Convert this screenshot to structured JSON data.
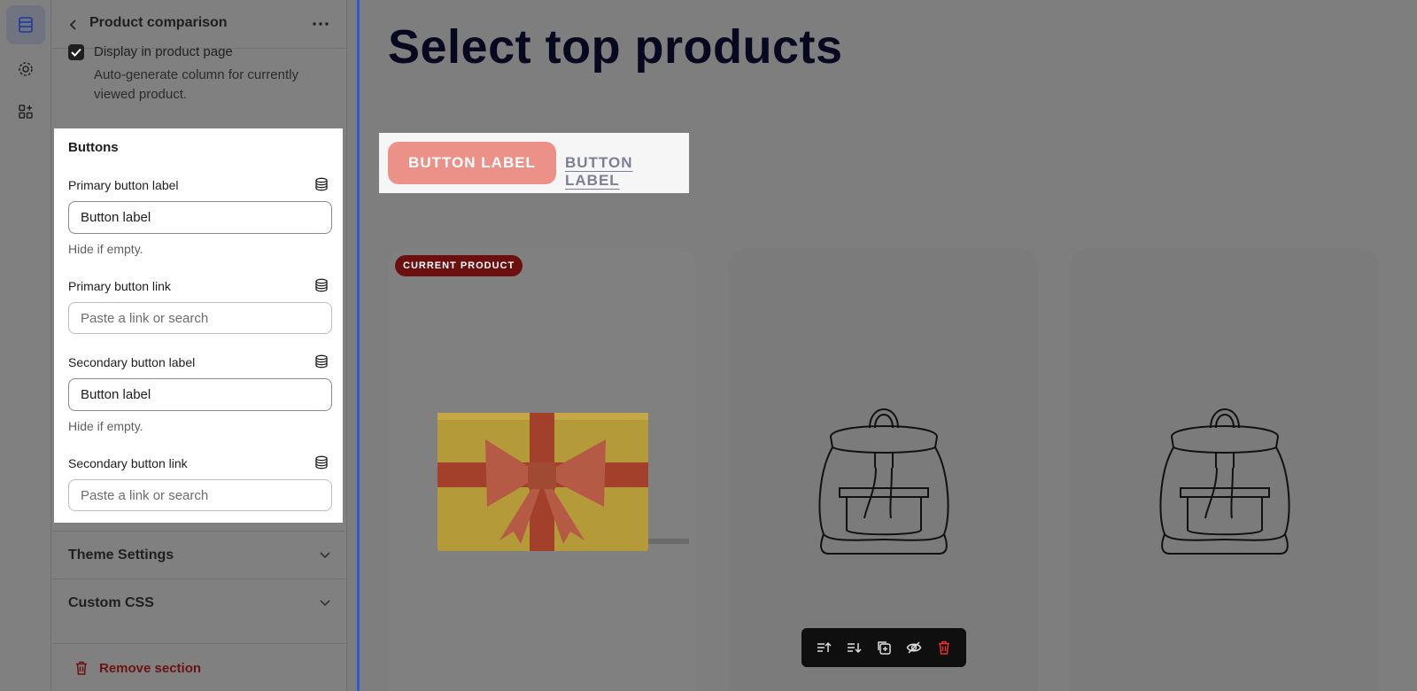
{
  "rail": {
    "icons": [
      "sections-icon",
      "settings-gear-icon",
      "apps-icon"
    ]
  },
  "panel": {
    "title": "Product comparison",
    "checkbox": {
      "label": "Display in product page",
      "checked": true,
      "help": "Auto-generate column for currently viewed product."
    },
    "buttons": {
      "heading": "Buttons",
      "primary_label": {
        "label": "Primary button label",
        "value": "Button label",
        "help": "Hide if empty."
      },
      "primary_link": {
        "label": "Primary button link",
        "placeholder": "Paste a link or search"
      },
      "secondary_label": {
        "label": "Secondary button label",
        "value": "Button label",
        "help": "Hide if empty."
      },
      "secondary_link": {
        "label": "Secondary button link",
        "placeholder": "Paste a link or search"
      }
    },
    "accordions": [
      {
        "label": "Theme Settings"
      },
      {
        "label": "Custom CSS"
      }
    ],
    "remove_label": "Remove section"
  },
  "preview": {
    "title": "Select top products",
    "primary_button": "BUTTON LABEL",
    "secondary_button": "BUTTON LABEL",
    "cards": [
      {
        "badge": "CURRENT PRODUCT",
        "image": "gift-box-image"
      },
      {
        "badge": "",
        "image": "backpack-image"
      },
      {
        "badge": "",
        "image": "backpack-image"
      }
    ],
    "toolbar": [
      "move-up-icon",
      "move-down-icon",
      "duplicate-icon",
      "hide-icon",
      "delete-icon"
    ]
  },
  "colors": {
    "accent": "#2a5bd7",
    "primary_button": "#ec9188",
    "badge": "#6b0f0f",
    "danger": "#e2342b"
  }
}
